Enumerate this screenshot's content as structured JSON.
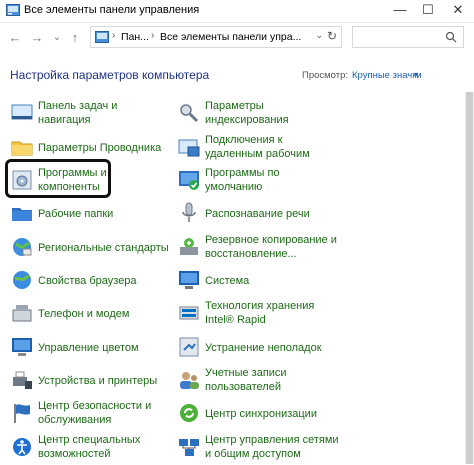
{
  "window": {
    "title": "Все элементы панели управления",
    "minimize_glyph": "—",
    "maximize_glyph": "☐",
    "close_glyph": "✕"
  },
  "nav": {
    "back_glyph": "←",
    "forward_glyph": "→",
    "recent_glyph": "⌄",
    "up_glyph": "↑"
  },
  "address": {
    "segments": [
      "Пан...",
      "Все элементы панели упра..."
    ],
    "separator": "›"
  },
  "search": {
    "placeholder": ""
  },
  "heading": "Настройка параметров компьютера",
  "view": {
    "label": "Просмотр:",
    "value": "Крупные значки",
    "arrow": "▾"
  },
  "colors": {
    "link": "#1d6b16",
    "heading": "#1e3287",
    "view_link": "#1a5fb4"
  },
  "items_left": [
    {
      "name": "taskbar",
      "icon": "taskbar-icon",
      "lines": [
        "Панель задач и",
        "навигация"
      ]
    },
    {
      "name": "explorer-options",
      "icon": "folder-options-icon",
      "lines": [
        "Параметры Проводника"
      ]
    },
    {
      "name": "programs",
      "icon": "programs-icon",
      "lines": [
        "Программы и",
        "компоненты"
      ]
    },
    {
      "name": "work-folders",
      "icon": "work-folders-icon",
      "lines": [
        "Рабочие папки"
      ]
    },
    {
      "name": "region",
      "icon": "region-icon",
      "lines": [
        "Региональные стандарты"
      ]
    },
    {
      "name": "internet-options",
      "icon": "internet-options-icon",
      "lines": [
        "Свойства браузера"
      ]
    },
    {
      "name": "phone-modem",
      "icon": "phone-modem-icon",
      "lines": [
        "Телефон и модем"
      ]
    },
    {
      "name": "color-management",
      "icon": "color-management-icon",
      "lines": [
        "Управление цветом"
      ]
    },
    {
      "name": "devices-printers",
      "icon": "printer-icon",
      "lines": [
        "Устройства и принтеры"
      ]
    },
    {
      "name": "security-center",
      "icon": "flag-icon",
      "lines": [
        "Центр безопасности и",
        "обслуживания"
      ]
    },
    {
      "name": "accessibility",
      "icon": "accessibility-icon",
      "lines": [
        "Центр специальных",
        "возможностей"
      ]
    }
  ],
  "items_right": [
    {
      "name": "indexing",
      "icon": "indexing-icon",
      "lines": [
        "Параметры",
        "индексирования"
      ]
    },
    {
      "name": "remoteapp",
      "icon": "remote-desktop-icon",
      "lines": [
        "Подключения к",
        "удаленным рабочим"
      ]
    },
    {
      "name": "default-programs",
      "icon": "default-programs-icon",
      "lines": [
        "Программы по",
        "умолчанию"
      ]
    },
    {
      "name": "speech",
      "icon": "microphone-icon",
      "lines": [
        "Распознавание речи"
      ]
    },
    {
      "name": "backup",
      "icon": "backup-icon",
      "lines": [
        "Резервное копирование и",
        "восстановление..."
      ]
    },
    {
      "name": "system",
      "icon": "system-icon",
      "lines": [
        "Система"
      ]
    },
    {
      "name": "intel-rst",
      "icon": "intel-rst-icon",
      "lines": [
        "Технология хранения",
        "Intel® Rapid"
      ]
    },
    {
      "name": "troubleshooting",
      "icon": "troubleshooting-icon",
      "lines": [
        "Устранение неполадок"
      ]
    },
    {
      "name": "user-accounts",
      "icon": "users-icon",
      "lines": [
        "Учетные записи",
        "пользователей"
      ]
    },
    {
      "name": "sync-center",
      "icon": "sync-icon",
      "lines": [
        "Центр синхронизации"
      ]
    },
    {
      "name": "network-center",
      "icon": "network-icon",
      "lines": [
        "Центр управления сетями",
        "и общим доступом"
      ]
    }
  ]
}
